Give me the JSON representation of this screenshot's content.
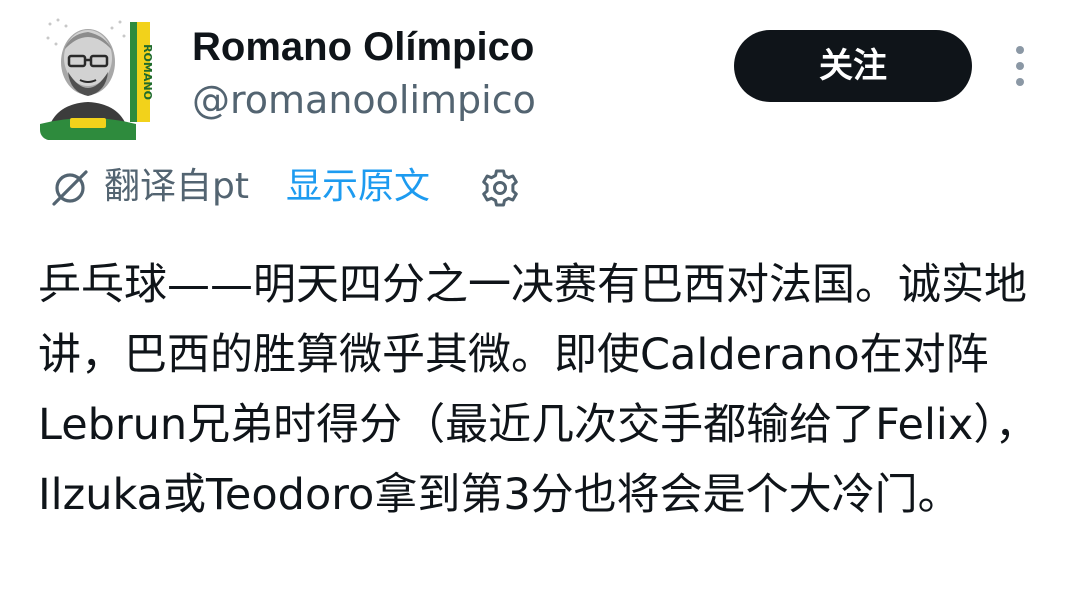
{
  "user": {
    "display_name": "Romano Olímpico",
    "handle": "@romanoolimpico",
    "avatar_side_text": "ROMANO",
    "avatar_icon": "profile-photo"
  },
  "follow_button": {
    "label": "关注"
  },
  "more_menu": {
    "icon": "more-vertical-icon"
  },
  "translation": {
    "translated_from": "翻译自pt",
    "show_original": "显示原文",
    "icon": "translate-icon",
    "settings_icon": "gear-icon"
  },
  "tweet": {
    "text": "乒乓球——明天四分之一决赛有巴西对法国。诚实地讲，巴西的胜算微乎其微。即使Calderano在对阵Lebrun兄弟时得分（最近几次交手都输给了Felix），Ilzuka或Teodoro拿到第3分也将会是个大冷门。"
  },
  "colors": {
    "text_primary": "#0f1419",
    "text_secondary": "#536471",
    "link": "#1d9bf0",
    "button_bg": "#0f1419",
    "avatar_green": "#2e8b3d",
    "avatar_yellow": "#f2d21b"
  }
}
